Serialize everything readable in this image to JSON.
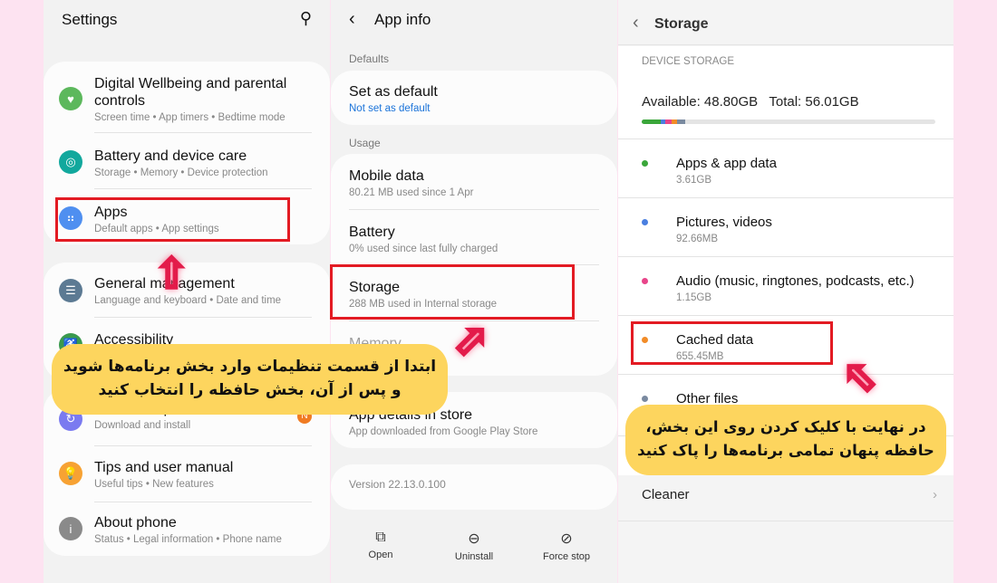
{
  "settings": {
    "title": "Settings",
    "items": [
      {
        "title": "Digital Wellbeing and parental controls",
        "sub": "Screen time  •  App timers  •  Bedtime mode",
        "color": "#5cb85c",
        "icon": "wellbeing-icon"
      },
      {
        "title": "Battery and device care",
        "sub": "Storage  •  Memory  •  Device protection",
        "color": "#12a89d",
        "icon": "device-care-icon"
      },
      {
        "title": "Apps",
        "sub": "Default apps  •  App settings",
        "color": "#4f8ff0",
        "icon": "apps-icon"
      },
      {
        "title": "General management",
        "sub": "Language and keyboard  •  Date and time",
        "color": "#5c7a93",
        "icon": "sliders-icon"
      },
      {
        "title": "Accessibility",
        "sub": "",
        "color": "#3a9a4e",
        "icon": "accessibility-icon"
      },
      {
        "title": "Software update",
        "sub": "Download and install",
        "color": "#7a7af0",
        "icon": "update-icon",
        "badge": "N"
      },
      {
        "title": "Tips and user manual",
        "sub": "Useful tips  •  New features",
        "color": "#f7a233",
        "icon": "tips-icon"
      },
      {
        "title": "About phone",
        "sub": "Status  •  Legal information  •  Phone name",
        "color": "#8a8a8a",
        "icon": "info-icon"
      }
    ]
  },
  "appinfo": {
    "title": "App info",
    "defaults_label": "Defaults",
    "set_default": "Set as default",
    "set_default_sub": "Not set as default",
    "usage_label": "Usage",
    "usage": [
      {
        "title": "Mobile data",
        "sub": "80.21 MB used since 1 Apr"
      },
      {
        "title": "Battery",
        "sub": "0% used since last fully charged"
      },
      {
        "title": "Storage",
        "sub": "288 MB used in Internal storage"
      },
      {
        "title": "Memory",
        "sub": ""
      }
    ],
    "store_title": "App details in store",
    "store_sub": "App downloaded from Google Play Store",
    "version": "Version 22.13.0.100",
    "buttons": [
      {
        "label": "Open",
        "icon": "open-external-icon"
      },
      {
        "label": "Uninstall",
        "icon": "uninstall-icon"
      },
      {
        "label": "Force stop",
        "icon": "force-stop-icon"
      }
    ]
  },
  "storage": {
    "title": "Storage",
    "section": "DEVICE STORAGE",
    "available": "Available: 48.80GB   Total: 56.01GB",
    "items": [
      {
        "title": "Apps & app data",
        "size": "3.61GB",
        "color": "#3aa63a"
      },
      {
        "title": "Pictures, videos",
        "size": "92.66MB",
        "color": "#4a7fe0"
      },
      {
        "title": "Audio (music, ringtones, podcasts, etc.)",
        "size": "1.15GB",
        "color": "#e8458a"
      },
      {
        "title": "Cached data",
        "size": "655.45MB",
        "color": "#f28c28"
      },
      {
        "title": "Other files",
        "size": "",
        "color": "#7a8aa0"
      }
    ],
    "cleaner": "Cleaner"
  },
  "annotations": {
    "bubble1_line1": "ابتدا از قسمت تنظیمات وارد بخش برنامه‌ها شوید",
    "bubble1_line2": "و پس از آن، بخش حافظه را انتخاب کنید",
    "bubble2_line1": "در نهایت با کلیک کردن  روی این بخش،",
    "bubble2_line2": "حافظه پنهان تمامی برنامه‌ها را پاک کنید",
    "highlight_color": "#e31b23",
    "bubble_color": "#fdd55e"
  }
}
